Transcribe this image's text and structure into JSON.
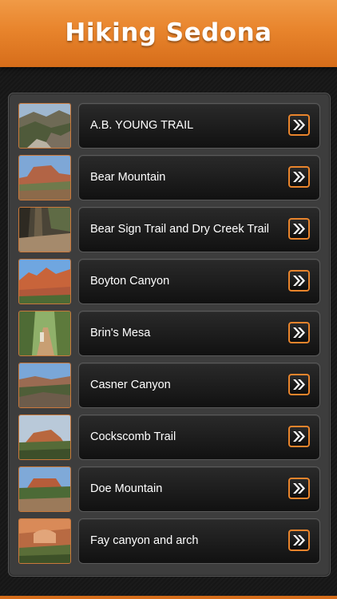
{
  "header": {
    "title": "Hiking Sedona",
    "accent_color": "#e8842c"
  },
  "trails": [
    {
      "name": "A.B. YOUNG TRAIL",
      "thumb_icon": "trail-photo"
    },
    {
      "name": "Bear Mountain",
      "thumb_icon": "trail-photo"
    },
    {
      "name": "Bear Sign Trail and Dry Creek Trail",
      "thumb_icon": "trail-photo"
    },
    {
      "name": "Boyton Canyon",
      "thumb_icon": "trail-photo"
    },
    {
      "name": "Brin's Mesa",
      "thumb_icon": "trail-photo"
    },
    {
      "name": "Casner Canyon",
      "thumb_icon": "trail-photo"
    },
    {
      "name": "Cockscomb Trail",
      "thumb_icon": "trail-photo"
    },
    {
      "name": "Doe Mountain",
      "thumb_icon": "trail-photo"
    },
    {
      "name": "Fay canyon and arch",
      "thumb_icon": "trail-photo"
    }
  ],
  "row_action_icon": "double-chevron-right-icon"
}
